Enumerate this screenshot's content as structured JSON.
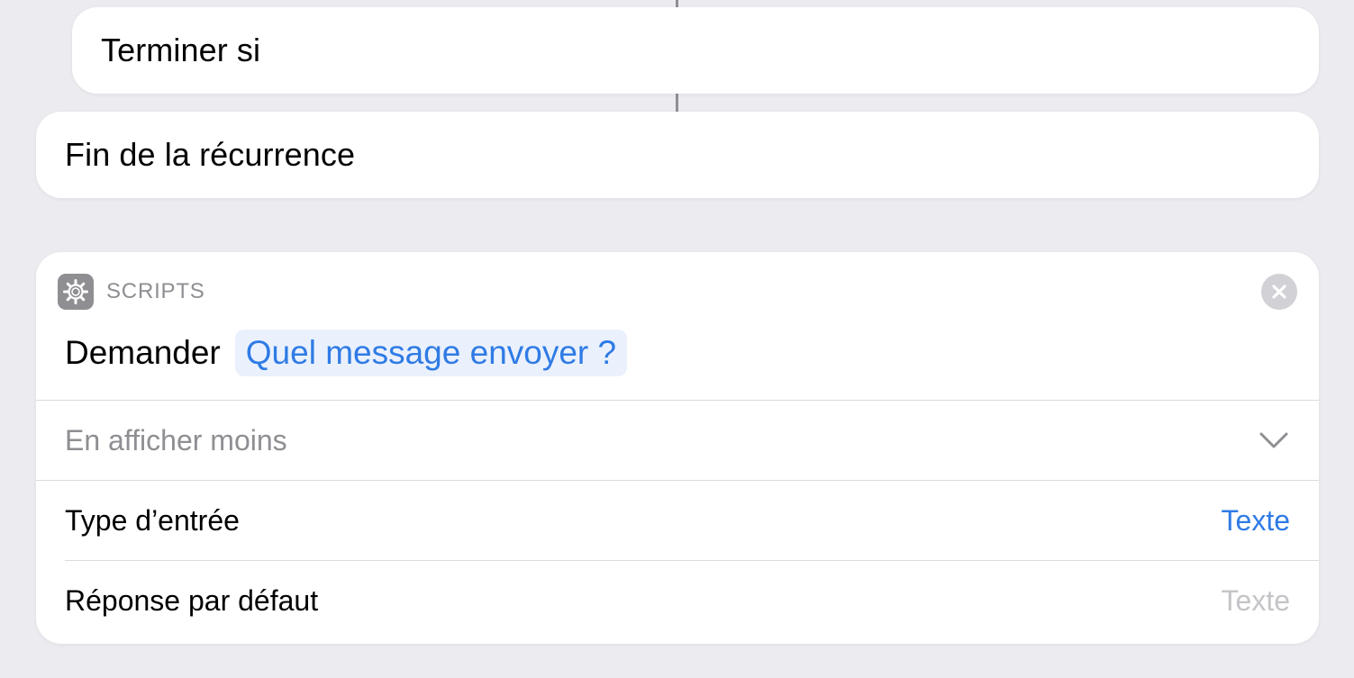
{
  "blocks": {
    "terminer_si": {
      "title": "Terminer si"
    },
    "fin_recurrence": {
      "title": "Fin de la récurrence"
    }
  },
  "scripts_action": {
    "category_label": "SCRIPTS",
    "category_icon": "gear-icon",
    "close_icon": "close-icon",
    "action_label": "Demander",
    "prompt_text": "Quel message envoyer ?",
    "show_less_label": "En afficher moins",
    "show_less_icon": "chevron-down-icon",
    "params": [
      {
        "label": "Type d’entrée",
        "value": "Texte",
        "is_placeholder": false
      },
      {
        "label": "Réponse par défaut",
        "value": "Texte",
        "is_placeholder": true
      }
    ]
  },
  "colors": {
    "background": "#ebebf0",
    "accent_blue": "#2f7be5",
    "secondary_gray": "#8e8e93",
    "placeholder_gray": "#c4c4c8",
    "pill_background": "#eaf1fd"
  }
}
